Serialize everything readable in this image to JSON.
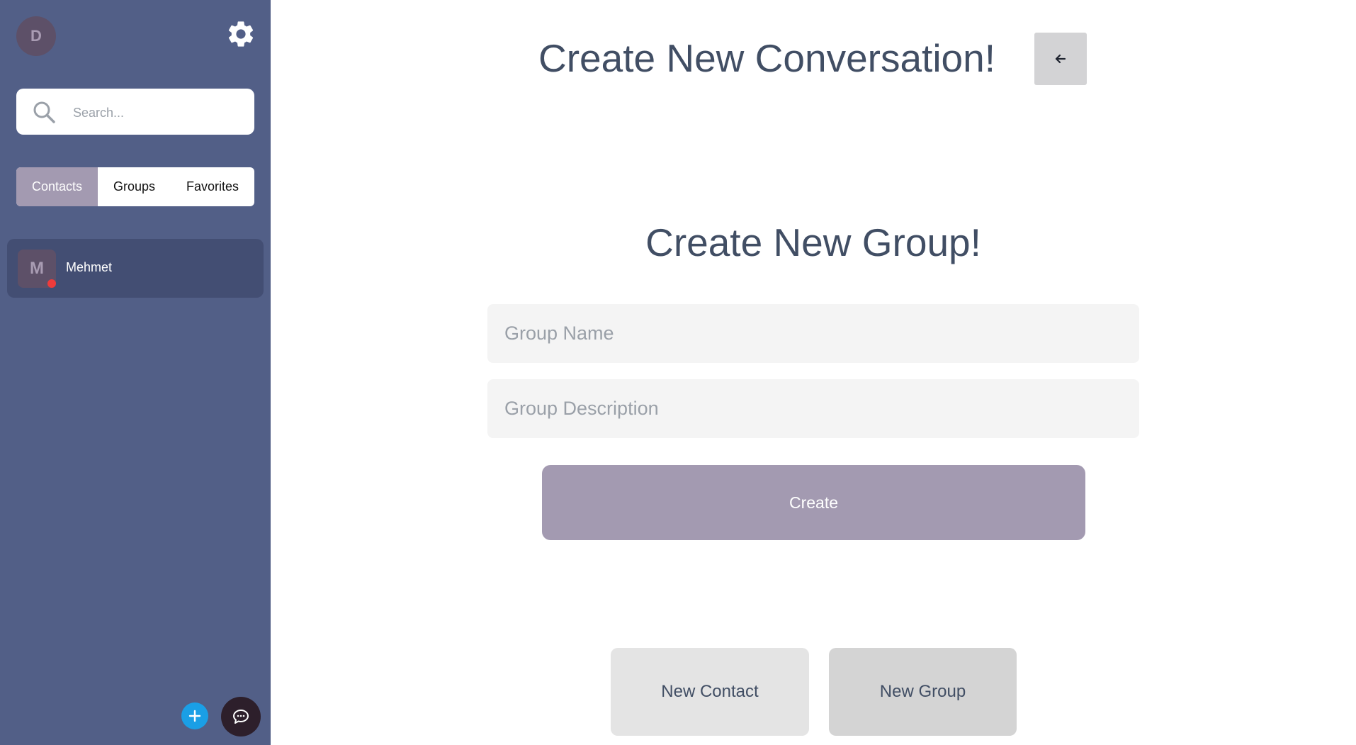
{
  "sidebar": {
    "user_initial": "D",
    "settings_icon": "gear-icon",
    "search": {
      "placeholder": "Search...",
      "value": "",
      "icon": "search-icon"
    },
    "tabs": [
      {
        "label": "Contacts",
        "active": true
      },
      {
        "label": "Groups",
        "active": false
      },
      {
        "label": "Favorites",
        "active": false
      }
    ],
    "contacts": [
      {
        "initial": "M",
        "name": "Mehmet",
        "status": "offline",
        "status_color": "#ef3b3b"
      }
    ],
    "fab": {
      "add_icon": "plus-icon",
      "chat_icon": "chat-bubble-icon"
    }
  },
  "main": {
    "title": "Create New Conversation!",
    "back_icon": "arrow-left-icon",
    "form": {
      "title": "Create New Group!",
      "group_name": {
        "placeholder": "Group Name",
        "value": ""
      },
      "group_description": {
        "placeholder": "Group Description",
        "value": ""
      },
      "create_label": "Create"
    },
    "mode_buttons": {
      "new_contact": "New Contact",
      "new_group": "New Group"
    }
  },
  "colors": {
    "sidebar_bg": "#525f87",
    "accent": "#a39ab1",
    "contact_selected_bg": "#434e73",
    "add_button": "#1a9fe6",
    "chat_button": "#2d1f2b",
    "title_text": "#414e64"
  }
}
